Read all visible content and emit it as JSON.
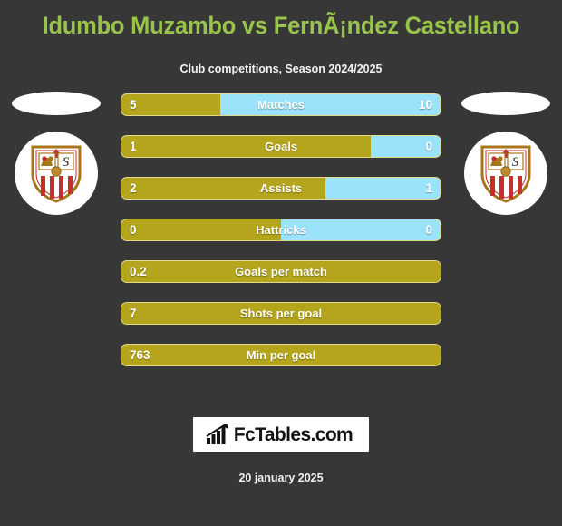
{
  "header": {
    "title": "Idumbo Muzambo vs FernÃ¡ndez Castellano",
    "subtitle": "Club competitions, Season 2024/2025"
  },
  "colors": {
    "background": "#373737",
    "title_green": "#99c44c",
    "bar_gold": "#b5a51c",
    "bar_blue": "#9ae3fa",
    "bar_border": "#e2d98a",
    "text_white": "#ffffff"
  },
  "players": {
    "left": {
      "crest_name": "sevilla-fc-crest",
      "photo": "player-photo-placeholder"
    },
    "right": {
      "crest_name": "sevilla-fc-crest",
      "photo": "player-photo-placeholder"
    }
  },
  "footer": {
    "brand": "FcTables.com",
    "brand_icon": "bar-chart-arrow-icon",
    "date": "20 january 2025"
  },
  "chart_data": {
    "type": "bar",
    "title": "Idumbo Muzambo vs FernÃ¡ndez Castellano",
    "subtitle": "Club competitions, Season 2024/2025",
    "orientation": "horizontal-diverging",
    "legend": [
      {
        "name": "Idumbo Muzambo",
        "color": "#b5a51c",
        "side": "left"
      },
      {
        "name": "FernÃ¡ndez Castellano",
        "color": "#9ae3fa",
        "side": "right"
      }
    ],
    "categories": [
      "Matches",
      "Goals",
      "Assists",
      "Hattricks",
      "Goals per match",
      "Shots per goal",
      "Min per goal"
    ],
    "series": [
      {
        "name": "Idumbo Muzambo",
        "values": [
          "5",
          "1",
          "2",
          "0",
          "0.2",
          "7",
          "763"
        ]
      },
      {
        "name": "FernÃ¡ndez Castellano",
        "values": [
          "10",
          "0",
          "1",
          "0",
          null,
          null,
          null
        ]
      }
    ],
    "rows": [
      {
        "label": "Matches",
        "left_value": "5",
        "right_value": "10",
        "left_pct": 31,
        "has_right": true
      },
      {
        "label": "Goals",
        "left_value": "1",
        "right_value": "0",
        "left_pct": 78,
        "has_right": true
      },
      {
        "label": "Assists",
        "left_value": "2",
        "right_value": "1",
        "left_pct": 64,
        "has_right": true
      },
      {
        "label": "Hattricks",
        "left_value": "0",
        "right_value": "0",
        "left_pct": 50,
        "has_right": true
      },
      {
        "label": "Goals per match",
        "left_value": "0.2",
        "right_value": "",
        "left_pct": 100,
        "has_right": false
      },
      {
        "label": "Shots per goal",
        "left_value": "7",
        "right_value": "",
        "left_pct": 100,
        "has_right": false
      },
      {
        "label": "Min per goal",
        "left_value": "763",
        "right_value": "",
        "left_pct": 100,
        "has_right": false
      }
    ]
  }
}
